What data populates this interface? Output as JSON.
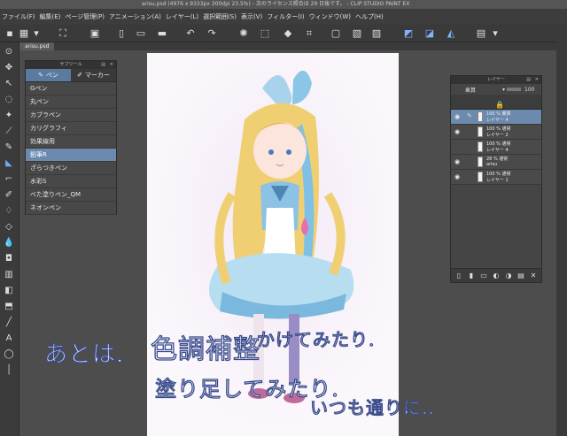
{
  "window": {
    "title": "arisu.psd (4976 x 9333px 300dpi 23.5%)  - 次のライセンス照合は 29 日後です。 - CLIP STUDIO PAINT EX"
  },
  "menu": [
    "ファイル(F)",
    "編集(E)",
    "ページ管理(P)",
    "アニメーション(A)",
    "レイヤー(L)",
    "選択範囲(S)",
    "表示(V)",
    "フィルター(I)",
    "ウィンドウ(W)",
    "ヘルプ(H)"
  ],
  "document_tab": "arisu.psd",
  "sub_tool": {
    "title": "サブツール",
    "tabs": [
      "ペン",
      "マーカー"
    ],
    "items": [
      "Gペン",
      "丸ペン",
      "カブラペン",
      "カリグラフィ",
      "効果線用",
      "鉛筆R",
      "ざらつきペン",
      "水彩S",
      "べた塗りペン_QM",
      "ネオンペン"
    ],
    "selected_index": 5
  },
  "layer_panel": {
    "title": "レイヤー",
    "blend_mode": "乗算",
    "opacity": "100",
    "layers": [
      {
        "line1": "100 % 乗算",
        "line2": "レイヤー 4",
        "selected": true
      },
      {
        "line1": "100 % 通常",
        "line2": "レイヤー 2",
        "selected": false
      },
      {
        "line1": "100 % 通常",
        "line2": "レイヤー 4",
        "selected": false
      },
      {
        "line1": "28 % 通常",
        "line2": "arisu",
        "selected": false
      },
      {
        "line1": "100 % 通常",
        "line2": "レイヤー 1",
        "selected": false
      }
    ]
  },
  "overlay_text": {
    "line1a": "あとは.",
    "line1b": "色調補整",
    "line1c": "かけてみたり.",
    "line2": "塗り足してみたり.",
    "line3": "いつも通りに.."
  },
  "colors": {
    "selection": "#6c8aad",
    "panel": "#454545",
    "canvas_bg": "#4d4d4d"
  }
}
